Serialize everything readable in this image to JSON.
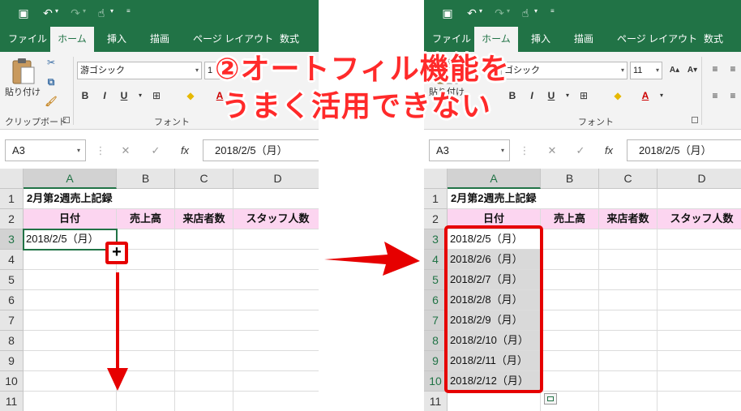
{
  "callout": {
    "line1": "②オートフィル機能を",
    "line2": "うまく活用できない"
  },
  "colors": {
    "excel_green": "#217346",
    "header_pink": "#fcd5f0",
    "highlight_red": "#e60000",
    "callout_red": "#ff2a2a"
  },
  "ribbon": {
    "tabs": [
      "ファイル",
      "ホーム",
      "挿入",
      "描画",
      "ページ レイアウト",
      "数式"
    ],
    "active_tab": "ホーム",
    "paste_label": "貼り付け",
    "clipboard_group": "クリップボード",
    "font_group": "フォント",
    "left_font_name": "游ゴシック",
    "left_font_size": "1",
    "right_font_name": "ゴシック",
    "right_font_size": "11",
    "bold": "B",
    "italic": "I",
    "underline": "U",
    "font_color_letter": "A"
  },
  "qat_icons": [
    "save-icon",
    "undo-icon",
    "redo-icon",
    "touch-mode-icon",
    "customize-icon"
  ],
  "formula_bar": {
    "name_box": "A3",
    "formula": "2018/2/5（月）",
    "cancel": "✕",
    "enter": "✓",
    "fx": "fx"
  },
  "sheet": {
    "columns": [
      "A",
      "B",
      "C",
      "D"
    ],
    "title": "2月第2週売上記録",
    "headers": [
      "日付",
      "売上高",
      "来店者数",
      "スタッフ人数"
    ],
    "left_rows": [
      "1",
      "2",
      "3",
      "4",
      "5",
      "6",
      "7",
      "8",
      "9",
      "10",
      "11"
    ],
    "right_rows": [
      "1",
      "2",
      "3",
      "4",
      "5",
      "6",
      "7",
      "8",
      "9",
      "10",
      "11"
    ],
    "left_a3": "2018/2/5（月）",
    "right_dates": [
      "2018/2/5（月）",
      "2018/2/6（月）",
      "2018/2/7（月）",
      "2018/2/8（月）",
      "2018/2/9（月）",
      "2018/2/10（月）",
      "2018/2/11（月）",
      "2018/2/12（月）"
    ]
  }
}
